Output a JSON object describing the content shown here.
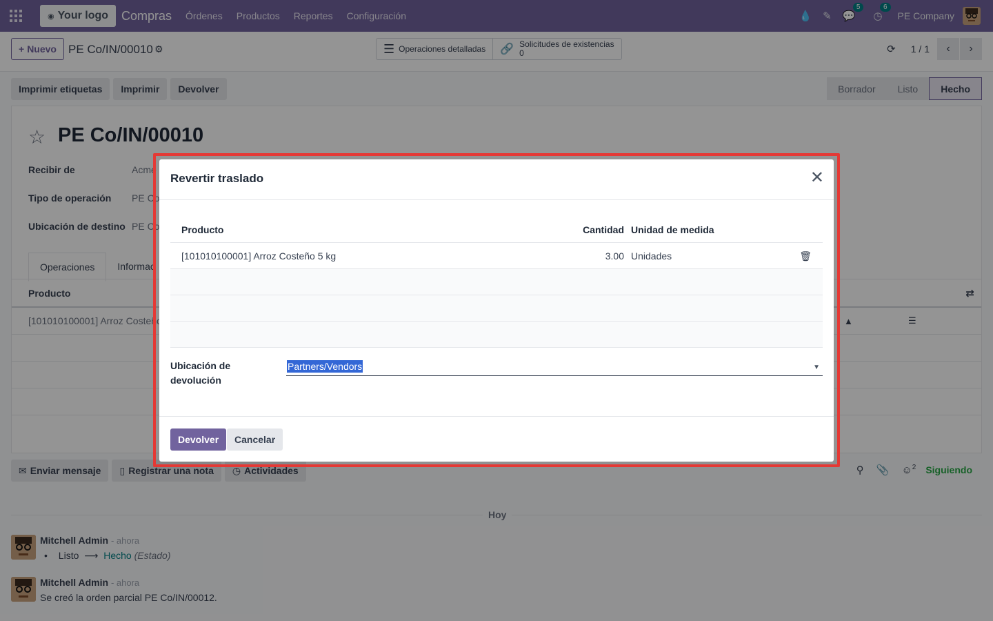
{
  "topnav": {
    "logo_text": "Your logo",
    "app_name": "Compras",
    "menu": [
      "Órdenes",
      "Productos",
      "Reportes",
      "Configuración"
    ],
    "messages_badge": "5",
    "activities_badge": "6",
    "company": "PE Company"
  },
  "controlbar": {
    "new_label": "Nuevo",
    "record_title": "PE Co/IN/00010",
    "smart_buttons": {
      "detailed_ops": "Operaciones detalladas",
      "stock_requests_label": "Solicitudes de existencias",
      "stock_requests_count": "0"
    },
    "pager": "1 / 1"
  },
  "actions": {
    "print_labels": "Imprimir etiquetas",
    "print": "Imprimir",
    "return": "Devolver"
  },
  "statusbar": [
    "Borrador",
    "Listo",
    "Hecho"
  ],
  "sheet": {
    "title": "PE Co/IN/00010",
    "fields": [
      {
        "label": "Recibir de",
        "value": "Acme"
      },
      {
        "label": "Tipo de operación",
        "value": "PE Co"
      },
      {
        "label": "Ubicación de destino",
        "value": "PE Co/"
      }
    ],
    "tabs": [
      "Operaciones",
      "Informac"
    ],
    "table_header": "Producto",
    "table_row": "[101010100001] Arroz Costeño"
  },
  "chatter": {
    "send_message": "Enviar mensaje",
    "log_note": "Registrar una nota",
    "activities": "Actividades",
    "followers_count": "2",
    "following": "Siguiendo",
    "separator": "Hoy",
    "messages": [
      {
        "author": "Mitchell Admin",
        "time": "- ahora",
        "old_value": "Listo",
        "new_value": "Hecho",
        "field": "(Estado)"
      },
      {
        "author": "Mitchell Admin",
        "time": "- ahora",
        "body": "Se creó la orden parcial PE Co/IN/00012."
      }
    ]
  },
  "modal": {
    "title": "Revertir traslado",
    "columns": {
      "product": "Producto",
      "quantity": "Cantidad",
      "uom": "Unidad de medida"
    },
    "rows": [
      {
        "product": "[101010100001] Arroz Costeño 5 kg",
        "quantity": "3.00",
        "uom": "Unidades"
      }
    ],
    "return_location_label": "Ubicación de devolución",
    "return_location_value": "Partners/Vendors",
    "confirm": "Devolver",
    "cancel": "Cancelar"
  },
  "colors": {
    "brand": "#71639e",
    "highlight_outline": "#e53935",
    "selection": "#3367d6",
    "following": "#28a745"
  }
}
